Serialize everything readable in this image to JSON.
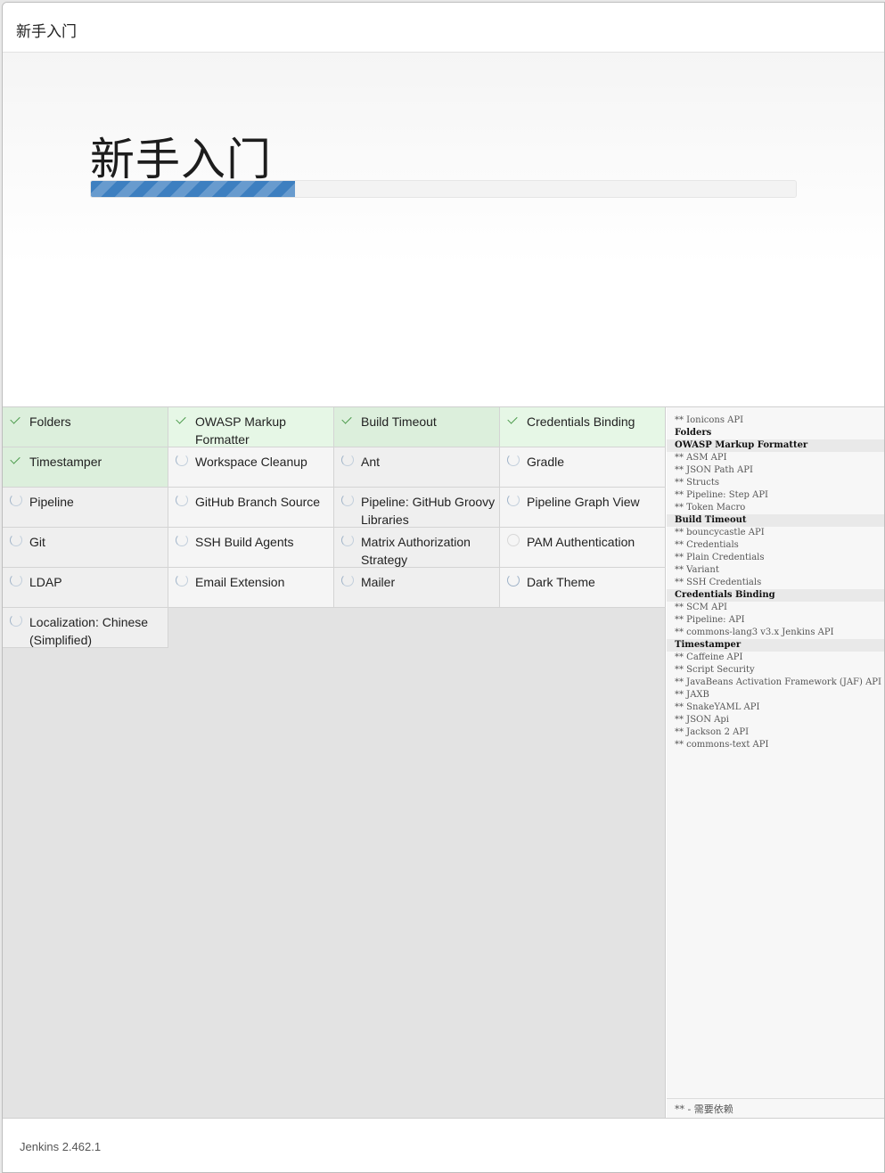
{
  "window": {
    "title": "新手入门"
  },
  "hero": {
    "heading": "新手入门",
    "progress": 0.29,
    "progress_color": "#3d7fc0"
  },
  "plugins": [
    {
      "name": "Folders",
      "status": "success"
    },
    {
      "name": "OWASP Markup Formatter",
      "status": "success"
    },
    {
      "name": "Build Timeout",
      "status": "success"
    },
    {
      "name": "Credentials Binding",
      "status": "success"
    },
    {
      "name": "Timestamper",
      "status": "success"
    },
    {
      "name": "Workspace Cleanup",
      "status": "pending"
    },
    {
      "name": "Ant",
      "status": "pending"
    },
    {
      "name": "Gradle",
      "status": "pending"
    },
    {
      "name": "Pipeline",
      "status": "pending"
    },
    {
      "name": "GitHub Branch Source",
      "status": "pending"
    },
    {
      "name": "Pipeline: GitHub Groovy Libraries",
      "status": "pending"
    },
    {
      "name": "Pipeline Graph View",
      "status": "pending"
    },
    {
      "name": "Git",
      "status": "pending"
    },
    {
      "name": "SSH Build Agents",
      "status": "pending"
    },
    {
      "name": "Matrix Authorization Strategy",
      "status": "pending"
    },
    {
      "name": "PAM Authentication",
      "status": "queued"
    },
    {
      "name": "LDAP",
      "status": "pending"
    },
    {
      "name": "Email Extension",
      "status": "pending"
    },
    {
      "name": "Mailer",
      "status": "pending"
    },
    {
      "name": "Dark Theme",
      "status": "installing"
    },
    {
      "name": "Localization: Chinese (Simplified)",
      "status": "pending"
    }
  ],
  "log": [
    {
      "text": "** Ionicons API",
      "kind": "dep"
    },
    {
      "text": "Folders",
      "kind": "plain-head"
    },
    {
      "text": "OWASP Markup Formatter",
      "kind": "head"
    },
    {
      "text": "** ASM API",
      "kind": "dep"
    },
    {
      "text": "** JSON Path API",
      "kind": "dep"
    },
    {
      "text": "** Structs",
      "kind": "dep"
    },
    {
      "text": "** Pipeline: Step API",
      "kind": "dep"
    },
    {
      "text": "** Token Macro",
      "kind": "dep"
    },
    {
      "text": "Build Timeout",
      "kind": "head"
    },
    {
      "text": "** bouncycastle API",
      "kind": "dep"
    },
    {
      "text": "** Credentials",
      "kind": "dep"
    },
    {
      "text": "** Plain Credentials",
      "kind": "dep"
    },
    {
      "text": "** Variant",
      "kind": "dep"
    },
    {
      "text": "** SSH Credentials",
      "kind": "dep"
    },
    {
      "text": "Credentials Binding",
      "kind": "head"
    },
    {
      "text": "** SCM API",
      "kind": "dep"
    },
    {
      "text": "** Pipeline: API",
      "kind": "dep"
    },
    {
      "text": "** commons-lang3 v3.x Jenkins API",
      "kind": "dep"
    },
    {
      "text": "Timestamper",
      "kind": "head"
    },
    {
      "text": "** Caffeine API",
      "kind": "dep"
    },
    {
      "text": "** Script Security",
      "kind": "dep"
    },
    {
      "text": "** JavaBeans Activation Framework (JAF) API",
      "kind": "dep"
    },
    {
      "text": "** JAXB",
      "kind": "dep"
    },
    {
      "text": "** SnakeYAML API",
      "kind": "dep"
    },
    {
      "text": "** JSON Api",
      "kind": "dep"
    },
    {
      "text": "** Jackson 2 API",
      "kind": "dep"
    },
    {
      "text": "** commons-text API",
      "kind": "dep"
    }
  ],
  "legend": "** - 需要依赖",
  "footer": {
    "version": "Jenkins 2.462.1"
  }
}
